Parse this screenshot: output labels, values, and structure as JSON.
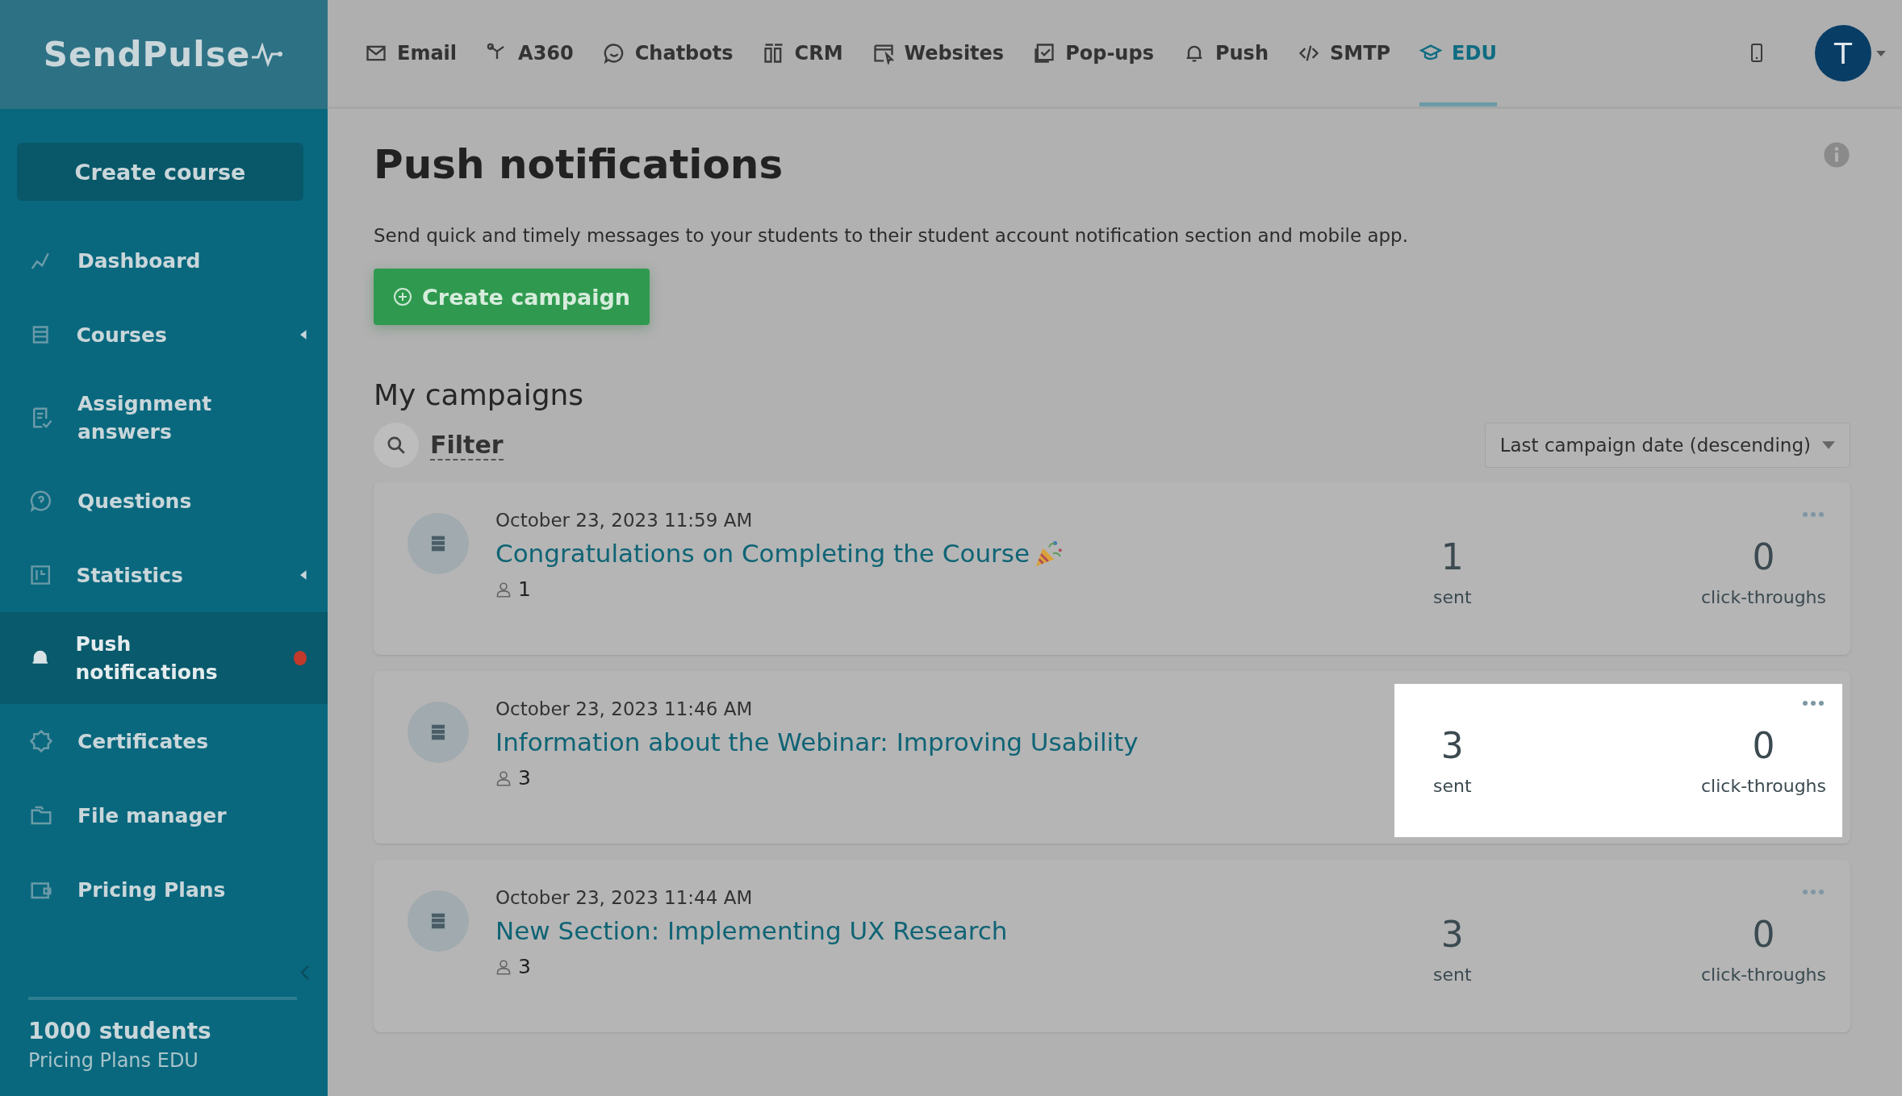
{
  "logo": "SendPulse",
  "nav": [
    {
      "label": "Email",
      "selected": false
    },
    {
      "label": "A360",
      "selected": false
    },
    {
      "label": "Chatbots",
      "selected": false
    },
    {
      "label": "CRM",
      "selected": false
    },
    {
      "label": "Websites",
      "selected": false
    },
    {
      "label": "Pop-ups",
      "selected": false
    },
    {
      "label": "Push",
      "selected": false
    },
    {
      "label": "SMTP",
      "selected": false
    },
    {
      "label": "EDU",
      "selected": true
    }
  ],
  "avatar": "T",
  "sidebar": {
    "create_button": "Create course",
    "items": [
      {
        "label": "Dashboard",
        "selected": false,
        "submenu": false,
        "alert": false
      },
      {
        "label": "Courses",
        "selected": false,
        "submenu": true,
        "alert": false
      },
      {
        "label": "Assignment answers",
        "selected": false,
        "submenu": false,
        "alert": false
      },
      {
        "label": "Questions",
        "selected": false,
        "submenu": false,
        "alert": false
      },
      {
        "label": "Statistics",
        "selected": false,
        "submenu": true,
        "alert": false
      },
      {
        "label": "Push notifications",
        "selected": true,
        "submenu": false,
        "alert": true
      },
      {
        "label": "Certificates",
        "selected": false,
        "submenu": false,
        "alert": false
      },
      {
        "label": "File manager",
        "selected": false,
        "submenu": false,
        "alert": false
      },
      {
        "label": "Pricing Plans",
        "selected": false,
        "submenu": false,
        "alert": false
      }
    ],
    "plan_count": "1000 students",
    "plan_name": "Pricing Plans EDU"
  },
  "page": {
    "title": "Push notifications",
    "description": "Send quick and timely messages to your students to their student account notification section and mobile app.",
    "create_button": "Create campaign",
    "section_title": "My campaigns",
    "filter": "Filter",
    "sort": "Last campaign date (descending)"
  },
  "campaigns": [
    {
      "date": "October 23, 2023 11:59 AM",
      "title": "Congratulations on Completing the Course",
      "party_icon": true,
      "recipients": "1",
      "sent": "1",
      "sent_label": "sent",
      "clicks": "0",
      "clicks_label": "click-throughs",
      "spotlight": false
    },
    {
      "date": "October 23, 2023 11:46 AM",
      "title": "Information about the Webinar: Improving Usability",
      "party_icon": false,
      "recipients": "3",
      "sent": "3",
      "sent_label": "sent",
      "clicks": "0",
      "clicks_label": "click-throughs",
      "spotlight": true
    },
    {
      "date": "October 23, 2023 11:44 AM",
      "title": "New Section: Implementing UX Research",
      "party_icon": false,
      "recipients": "3",
      "sent": "3",
      "sent_label": "sent",
      "clicks": "0",
      "clicks_label": "click-throughs",
      "spotlight": false
    }
  ]
}
